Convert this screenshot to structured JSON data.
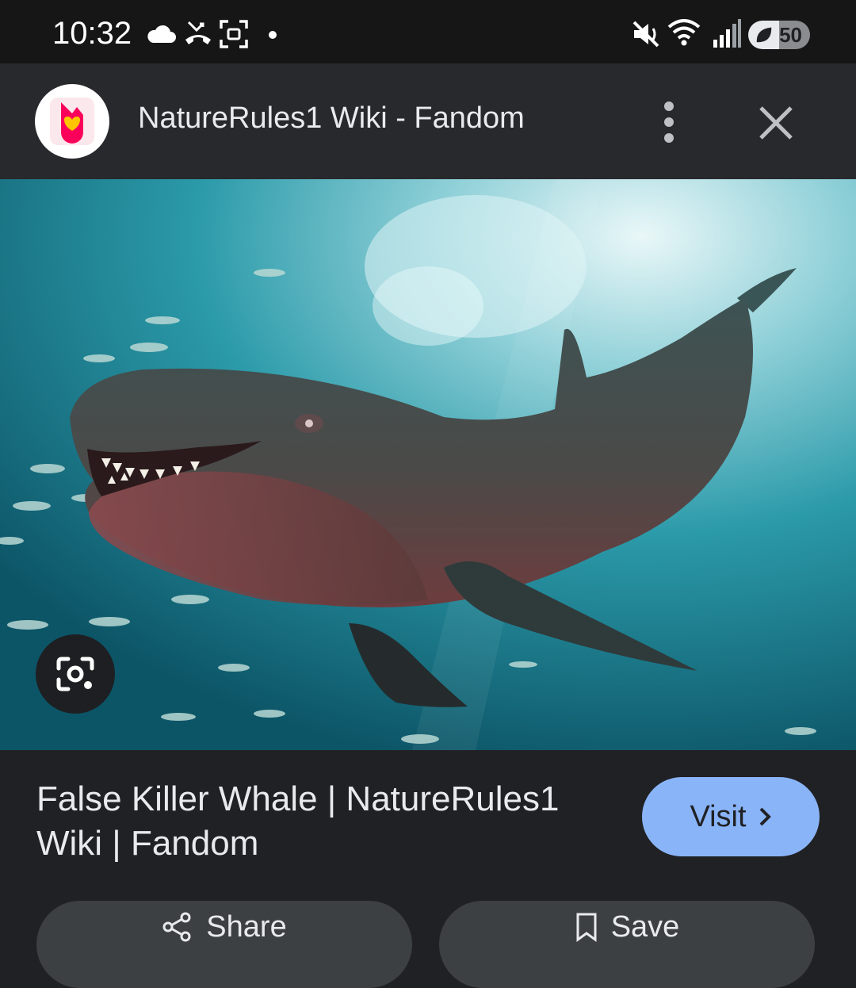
{
  "status_bar": {
    "time": "10:32",
    "battery": "50",
    "icons": [
      "cloud-icon",
      "missed-call-icon",
      "screenshot-icon",
      "dot-icon",
      "mute-icon",
      "wifi-icon",
      "signal-icon",
      "battery-saver-icon"
    ]
  },
  "header": {
    "site_title": "NatureRules1 Wiki - Fandom",
    "logo_icon": "fandom-logo-icon",
    "more_icon": "more-vert-icon",
    "close_icon": "close-icon"
  },
  "image": {
    "lens_icon": "google-lens-icon"
  },
  "result": {
    "title": "False Killer Whale | NatureRules1 Wiki | Fandom",
    "visit_label": "Visit"
  },
  "actions": {
    "share_label": "Share",
    "save_label": "Save"
  },
  "colors": {
    "accent": "#8ab4f8",
    "background": "#202124",
    "button_bg": "#3c4043"
  }
}
